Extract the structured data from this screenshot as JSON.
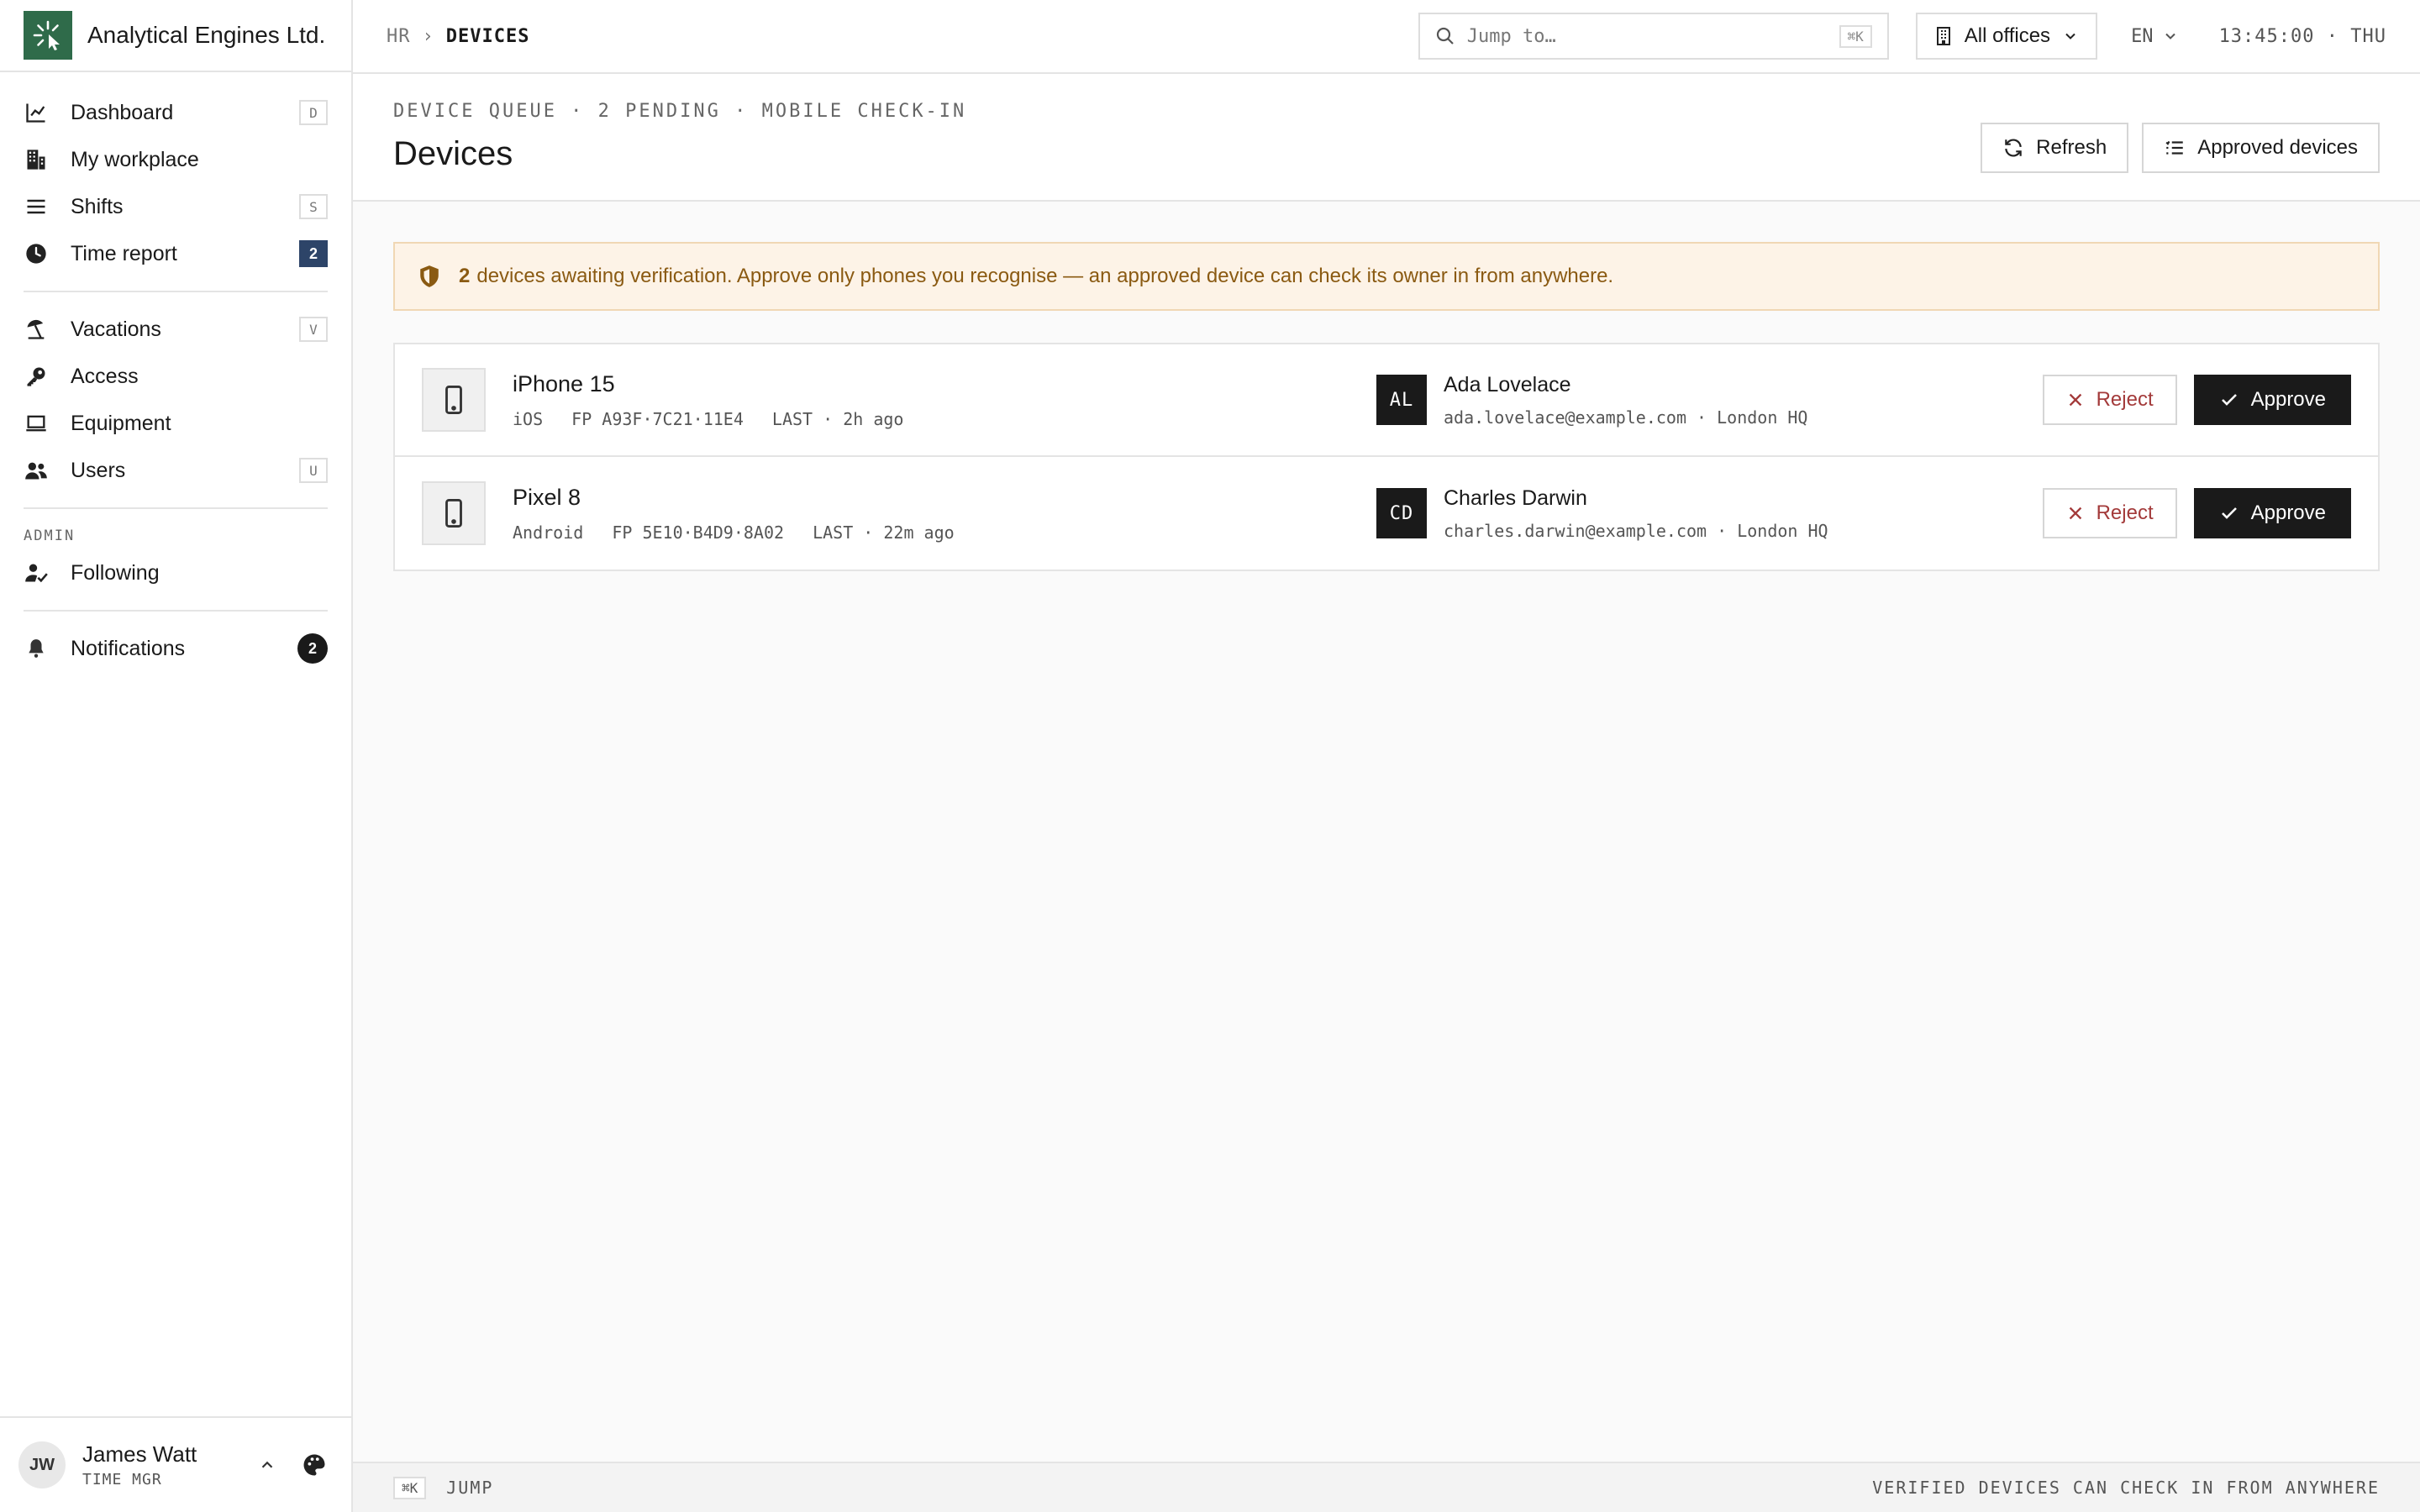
{
  "app": {
    "name": "Analytical Engines Ltd."
  },
  "sidebar": {
    "group1": [
      {
        "label": "Dashboard",
        "kbd": "D"
      },
      {
        "label": "My workplace"
      },
      {
        "label": "Shifts",
        "kbd": "S"
      },
      {
        "label": "Time report",
        "count": "2"
      }
    ],
    "group2": [
      {
        "label": "Vacations",
        "kbd": "V"
      },
      {
        "label": "Access"
      },
      {
        "label": "Equipment"
      },
      {
        "label": "Users",
        "kbd": "U"
      }
    ],
    "admin_label": "ADMIN",
    "admin": [
      {
        "label": "Following"
      }
    ],
    "notifications": {
      "label": "Notifications",
      "count": "2"
    }
  },
  "user": {
    "initials": "JW",
    "name": "James Watt",
    "role": "TIME MGR"
  },
  "topbar": {
    "crumbs": [
      "HR",
      "DEVICES"
    ],
    "crumb_sep": "›",
    "search_placeholder": "Jump to…",
    "search_kbd": "⌘K",
    "office": "All offices",
    "lang": "EN",
    "clock": "13:45:00 · THU"
  },
  "page": {
    "eyebrow": "DEVICE QUEUE · 2 PENDING · MOBILE CHECK-IN",
    "title": "Devices",
    "refresh_label": "Refresh",
    "approved_label": "Approved devices"
  },
  "alert": {
    "count": "2",
    "text": "devices awaiting verification. Approve only phones you recognise — an approved device can check its owner in from anywhere."
  },
  "devices": [
    {
      "name": "iPhone 15",
      "os": "iOS",
      "fp": "FP A93F·7C21·11E4",
      "last": "LAST · 2h ago",
      "owner_initials": "AL",
      "owner_name": "Ada Lovelace",
      "owner_meta": "ada.lovelace@example.com · London HQ",
      "reject": "Reject",
      "approve": "Approve"
    },
    {
      "name": "Pixel 8",
      "os": "Android",
      "fp": "FP 5E10·B4D9·8A02",
      "last": "LAST · 22m ago",
      "owner_initials": "CD",
      "owner_name": "Charles Darwin",
      "owner_meta": "charles.darwin@example.com · London HQ",
      "reject": "Reject",
      "approve": "Approve"
    }
  ],
  "statusbar": {
    "kbd": "⌘K",
    "jump": "JUMP",
    "right": "VERIFIED DEVICES CAN CHECK IN FROM ANYWHERE"
  },
  "colors": {
    "brand": "#2f6b4a",
    "alert_bg": "#fdf3e7",
    "alert_text": "#8a5a12",
    "reject": "#a33a3a",
    "badge_blue": "#2d4468"
  }
}
